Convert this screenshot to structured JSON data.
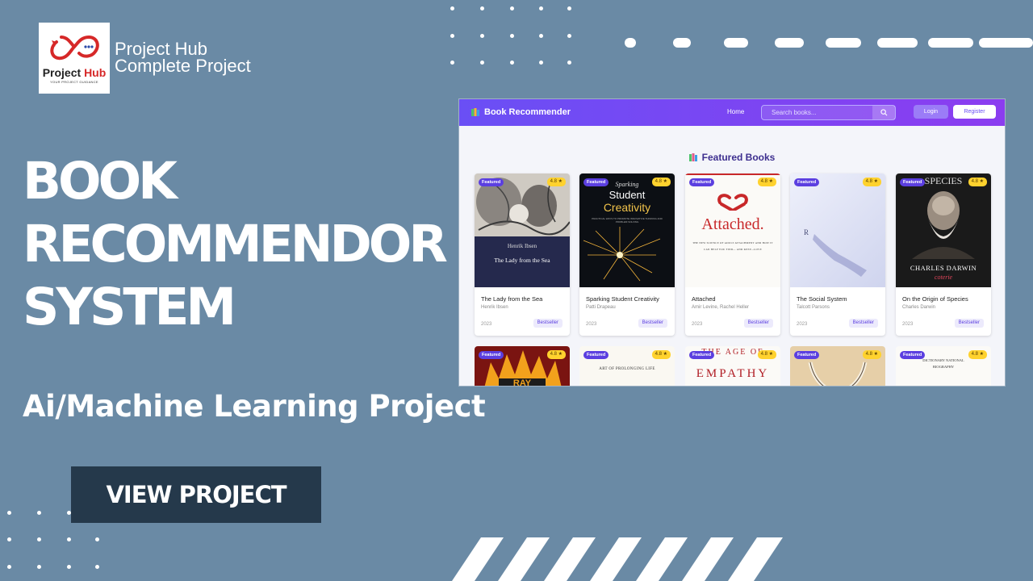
{
  "brand": {
    "logo_word_1": "Project",
    "logo_word_2": "Hub",
    "logo_tagline": "YOUR PROJECT GUIDANCE",
    "line1": "Project Hub",
    "line2": "Complete Project"
  },
  "headline": {
    "line1": "BOOK",
    "line2": "RECOMMENDOR",
    "line3": "SYSTEM"
  },
  "subtitle": "Ai/Machine Learning Project",
  "cta": {
    "label": "VIEW PROJECT"
  },
  "colors": {
    "background": "#6a8aa5",
    "button": "#25394b",
    "nav_start": "#6a4ff5",
    "nav_end": "#8b3df0",
    "logo_red": "#d62828"
  },
  "app": {
    "nav": {
      "title": "Book Recommender",
      "home": "Home",
      "search_placeholder": "Search books...",
      "login": "Login",
      "register": "Register"
    },
    "section_title": "Featured Books",
    "books": [
      {
        "title": "The Lady from the Sea",
        "author": "Henrik Ibsen",
        "year": "2023",
        "badge": "Bestseller",
        "featured": "Featured",
        "rating": "4.8 ★",
        "cover_author": "Henrik Ibsen",
        "cover_title": "The Lady from the Sea"
      },
      {
        "title": "Sparking Student Creativity",
        "author": "Patti Drapeau",
        "year": "2023",
        "badge": "Bestseller",
        "featured": "Featured",
        "rating": "4.8 ★",
        "cover_top": "Sparking",
        "cover_mid": "Student",
        "cover_big": "Creativity",
        "cover_small": "PRACTICAL WAYS TO PROMOTE INNOVATIVE THINKING AND PROBLEM SOLVING",
        "cover_author": "Patti Drapeau"
      },
      {
        "title": "Attached",
        "author": "Amir Levine, Rachel Heller",
        "year": "2023",
        "badge": "Bestseller",
        "featured": "Featured",
        "rating": "4.8 ★",
        "cover_big": "Attached.",
        "cover_small": "THE NEW SCIENCE OF ADULT ATTACHMENT AND HOW IT CAN HELP YOU FIND— AND KEEP—LOVE"
      },
      {
        "title": "The Social System",
        "author": "Talcott Parsons",
        "year": "2023",
        "badge": "Bestseller",
        "featured": "Featured",
        "rating": "4.8 ★",
        "cover_letter": "R"
      },
      {
        "title": "On the Origin of Species",
        "author": "Charles Darwin",
        "year": "2023",
        "badge": "Bestseller",
        "featured": "Featured",
        "rating": "4.8 ★",
        "cover_top": "SPECIES",
        "cover_author": "CHARLES DARWIN",
        "cover_series": "coterie"
      }
    ],
    "row2": [
      {
        "featured": "Featured",
        "rating": "4.8 ★",
        "cover_text": "RAY"
      },
      {
        "featured": "Featured",
        "rating": "4.8 ★",
        "cover_text": "ART OF PROLONGING LIFE"
      },
      {
        "featured": "Featured",
        "rating": "4.8 ★",
        "cover_top": "THE AGE OF",
        "cover_text": "EMPATHY"
      },
      {
        "featured": "Featured",
        "rating": "4.8 ★"
      },
      {
        "featured": "Featured",
        "rating": "4.8 ★",
        "cover_text": "DICTIONARY NATIONAL BIOGRAPHY"
      }
    ]
  }
}
